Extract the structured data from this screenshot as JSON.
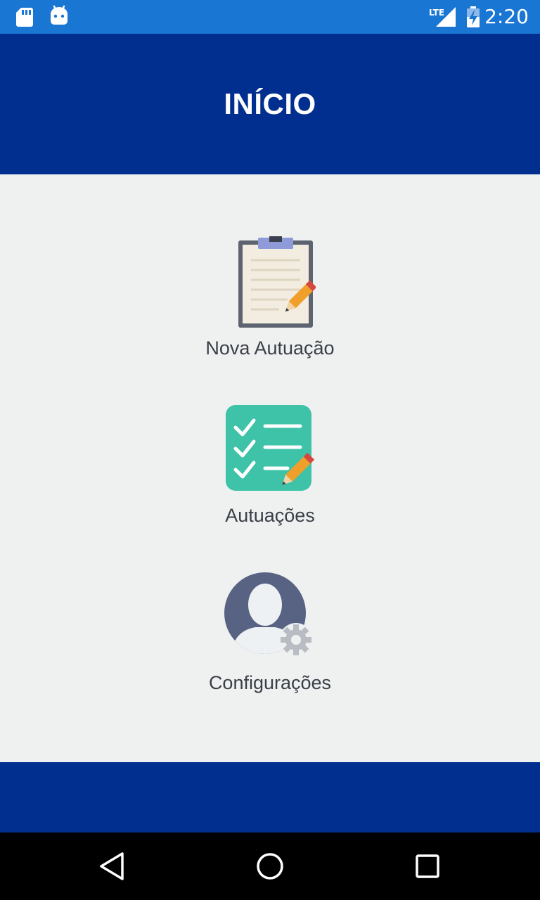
{
  "status_bar": {
    "time": "2:20",
    "left_icons": [
      "sd-card-icon",
      "android-debug-icon"
    ],
    "right_icons": [
      "lte-signal-icon",
      "battery-charging-icon"
    ],
    "network_label": "LTE",
    "background": "#1976d2"
  },
  "header": {
    "title": "INÍCIO",
    "background": "#002f8f"
  },
  "menu": {
    "items": [
      {
        "label": "Nova Autuação",
        "icon": "clipboard-pencil-icon"
      },
      {
        "label": "Autuações",
        "icon": "checklist-pencil-icon"
      },
      {
        "label": "Configurações",
        "icon": "user-settings-icon"
      }
    ]
  },
  "footer": {
    "background": "#002f8f"
  },
  "nav_bar": {
    "buttons": [
      "back-icon",
      "home-icon",
      "recents-icon"
    ]
  }
}
